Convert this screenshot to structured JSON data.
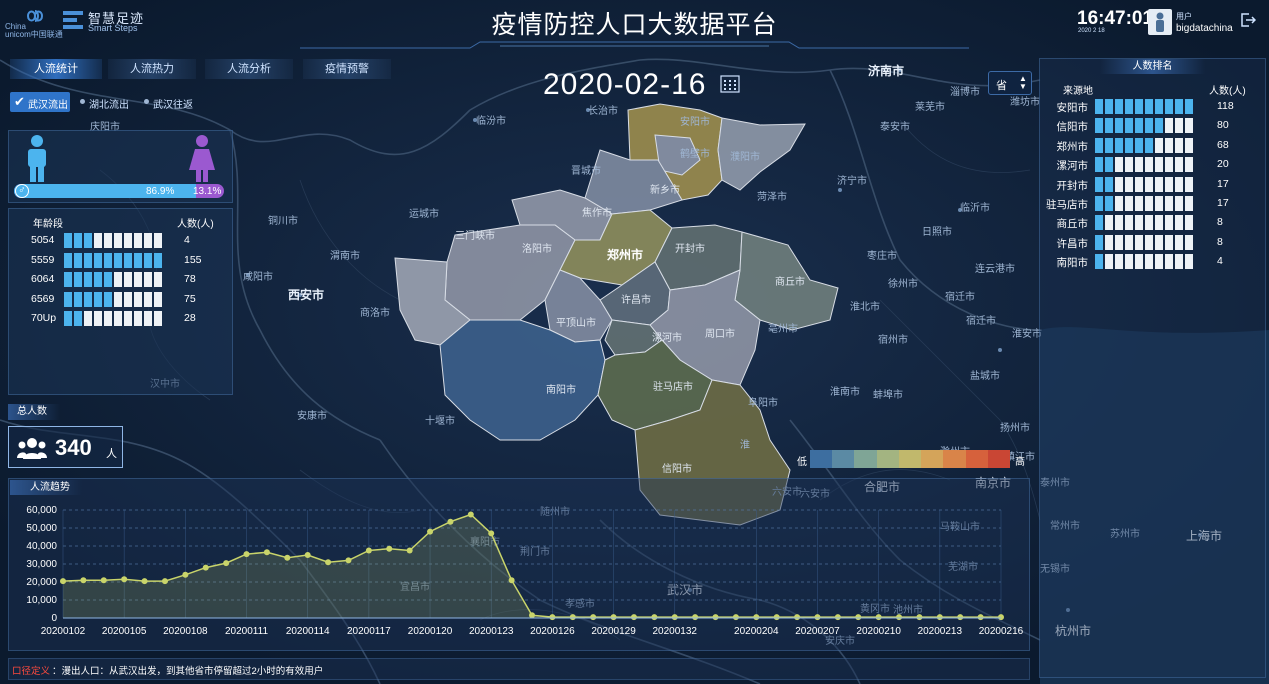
{
  "header": {
    "logo_china": "China",
    "logo_unicom": "unicom中国联通",
    "brand_cn": "智慧足迹",
    "brand_en": "Smart Steps",
    "title": "疫情防控人口大数据平台",
    "time": "16:47:01",
    "date_small": "2020 2 18",
    "user_label": "用户",
    "username": "bigdatachina"
  },
  "tabs": [
    {
      "label": "人流统计",
      "active": true
    },
    {
      "label": "人流热力",
      "active": false
    },
    {
      "label": "人流分析",
      "active": false
    },
    {
      "label": "疫情预警",
      "active": false
    }
  ],
  "filters": [
    {
      "label": "武汉流出",
      "selected": true
    },
    {
      "label": "湖北流出",
      "selected": false
    },
    {
      "label": "武汉往返",
      "selected": false
    }
  ],
  "map": {
    "date": "2020-02-16",
    "scope_select": "省",
    "legend_low": "低",
    "legend_high": "高",
    "legend_colors": [
      "#3d6ea0",
      "#5b8aa4",
      "#7fa596",
      "#a3b481",
      "#c1b86c",
      "#d4a45a",
      "#d98449",
      "#d6613c",
      "#c94634"
    ],
    "city_labels": [
      "济南市",
      "长治市",
      "临汾市",
      "晋城市",
      "运城市",
      "三门峡市",
      "洛阳市",
      "焦作市",
      "新乡市",
      "郑州市",
      "开封市",
      "商丘市",
      "许昌市",
      "平顶山市",
      "漯河市",
      "周口市",
      "南阳市",
      "驻马店市",
      "信阳市",
      "西安市",
      "渭南市",
      "商洛市",
      "安康市",
      "十堰市",
      "阜阳市",
      "六安市",
      "合肥市",
      "南京市",
      "上海市",
      "杭州市",
      "武汉市",
      "荆门市",
      "黄冈市",
      "亳州市",
      "宿州市",
      "徐州市",
      "菏泽市",
      "济宁市",
      "枣庄市",
      "临沂市",
      "泰安市",
      "蚌埠市",
      "淮南市",
      "淮北市",
      "汉中市",
      "咸阳市",
      "铜川市",
      "庆阳市",
      "淄博市",
      "潍坊市",
      "苏州市",
      "无锡市",
      "常州市",
      "镇江市",
      "扬州市",
      "泰州市",
      "淮安市",
      "盐城市",
      "连云港市",
      "宿迁市",
      "安阳市",
      "濮阳市",
      "鹤壁市",
      "宜昌市",
      "襄阳市",
      "孝感市",
      "随州市",
      "池州市",
      "安庆市",
      "芜湖市",
      "马鞍山市",
      "滁州市"
    ]
  },
  "gender": {
    "male_pct": "86.9%",
    "female_pct": "13.1%",
    "male_fraction": 0.869,
    "male_symbol": "♂"
  },
  "age": {
    "col_group": "年龄段",
    "col_count": "人数(人)",
    "rows": [
      {
        "label": "5054",
        "filled": 0.3,
        "count": "4"
      },
      {
        "label": "5559",
        "filled": 1.0,
        "count": "155"
      },
      {
        "label": "6064",
        "filled": 0.5,
        "count": "78"
      },
      {
        "label": "6569",
        "filled": 0.5,
        "count": "75"
      },
      {
        "label": "70Up",
        "filled": 0.2,
        "count": "28"
      }
    ]
  },
  "total": {
    "label": "总人数",
    "value": "340",
    "unit": "人"
  },
  "ranking": {
    "title": "人数排名",
    "col_source": "来源地",
    "col_count": "人数(人)",
    "rows": [
      {
        "city": "安阳市",
        "filled": 1.0,
        "count": "118"
      },
      {
        "city": "信阳市",
        "filled": 0.7,
        "count": "80"
      },
      {
        "city": "郑州市",
        "filled": 0.6,
        "count": "68"
      },
      {
        "city": "漯河市",
        "filled": 0.2,
        "count": "20"
      },
      {
        "city": "开封市",
        "filled": 0.2,
        "count": "17"
      },
      {
        "city": "驻马店市",
        "filled": 0.2,
        "count": "17"
      },
      {
        "city": "商丘市",
        "filled": 0.1,
        "count": "8"
      },
      {
        "city": "许昌市",
        "filled": 0.1,
        "count": "8"
      },
      {
        "city": "南阳市",
        "filled": 0.1,
        "count": "4"
      }
    ]
  },
  "trend": {
    "title": "人流趋势"
  },
  "footer": {
    "label": "口径定义",
    "text": "：漫出人口：从武汉出发，到其他省市停留超过2小时的有效用户"
  },
  "chart_data": {
    "type": "area",
    "title": "人流趋势",
    "x": [
      "20200102",
      "20200103",
      "20200104",
      "20200105",
      "20200106",
      "20200107",
      "20200108",
      "20200109",
      "20200110",
      "20200111",
      "20200112",
      "20200113",
      "20200114",
      "20200115",
      "20200116",
      "20200117",
      "20200118",
      "20200119",
      "20200120",
      "20200121",
      "20200122",
      "20200123",
      "20200124",
      "20200125",
      "20200126",
      "20200127",
      "20200128",
      "20200129",
      "20200130",
      "20200131",
      "20200132",
      "20200201",
      "20200202",
      "20200203",
      "20200204",
      "20200205",
      "20200206",
      "20200207",
      "20200208",
      "20200209",
      "20200210",
      "20200211",
      "20200212",
      "20200213",
      "20200214",
      "20200215",
      "20200216"
    ],
    "x_tick_labels": [
      "20200102",
      "20200105",
      "20200108",
      "20200111",
      "20200114",
      "20200117",
      "20200120",
      "20200123",
      "20200126",
      "20200129",
      "20200132",
      "20200204",
      "20200207",
      "20200210",
      "20200213",
      "20200216"
    ],
    "y": [
      20500,
      21000,
      21000,
      21500,
      20500,
      20500,
      24000,
      28000,
      30500,
      35500,
      36500,
      33500,
      35000,
      31000,
      32000,
      37500,
      38500,
      37500,
      48000,
      53500,
      57500,
      47000,
      21000,
      1500,
      500,
      500,
      500,
      500,
      500,
      500,
      500,
      500,
      500,
      500,
      500,
      500,
      500,
      500,
      500,
      500,
      500,
      500,
      500,
      500,
      500,
      500,
      500
    ],
    "ylim": [
      0,
      60000
    ],
    "yticks": [
      "0",
      "10,000",
      "20,000",
      "30,000",
      "40,000",
      "50,000",
      "60,000"
    ],
    "grid": true,
    "colors": {
      "line": "#c9d46a",
      "fill": "#c9d46a"
    }
  }
}
